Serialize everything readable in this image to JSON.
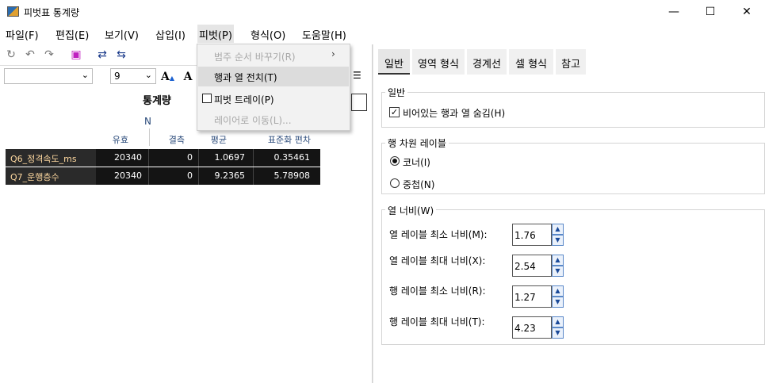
{
  "window": {
    "title": "피벗표 통계량",
    "minimize": "—",
    "maximize": "☐",
    "close": "✕"
  },
  "menubar": [
    {
      "label": "파일(F)"
    },
    {
      "label": "편집(E)"
    },
    {
      "label": "보기(V)"
    },
    {
      "label": "삽입(I)"
    },
    {
      "label": "피벗(P)"
    },
    {
      "label": "형식(O)"
    },
    {
      "label": "도움말(H)"
    }
  ],
  "toolbar": {
    "font_size": "9",
    "font_name": ""
  },
  "pivot_menu": {
    "items": [
      {
        "label": "범주 순서 바꾸기(R)",
        "submenu_arrow": "›",
        "enabled": false
      },
      {
        "label": "행과 열 전치(T)",
        "enabled": true,
        "highlighted": true
      },
      {
        "label": "피벗 트레이(P)",
        "enabled": true,
        "checked": false
      },
      {
        "label": "레이어로 이동(L)...",
        "enabled": false
      }
    ]
  },
  "table": {
    "title": "통계량",
    "n_header": "N",
    "columns": [
      "유효",
      "결측",
      "평균",
      "표준화 편차"
    ],
    "rows": [
      {
        "label": "Q6_정격속도_ms",
        "values": [
          "20340",
          "0",
          "1.0697",
          "0.35461"
        ]
      },
      {
        "label": "Q7_운행층수",
        "values": [
          "20340",
          "0",
          "9.2365",
          "5.78908"
        ]
      }
    ]
  },
  "tabs": [
    {
      "label": "일반",
      "active": true
    },
    {
      "label": "영역 형식",
      "active": false
    },
    {
      "label": "경계선",
      "active": false
    },
    {
      "label": "셀 형식",
      "active": false
    },
    {
      "label": "참고",
      "active": false
    }
  ],
  "general": {
    "group_label": "일반",
    "hide_empty_label": "비어있는 행과 열 숨김(H)",
    "hide_empty_checked": true
  },
  "row_dim": {
    "group_label": "행 차원 레이블",
    "corner_label": "코너(I)",
    "nested_label": "중첩(N)",
    "selected": "corner"
  },
  "col_width": {
    "group_label": "열 너비(W)",
    "fields": [
      {
        "label": "열 레이블 최소 너비(M):",
        "value": "1.76"
      },
      {
        "label": "열 레이블 최대 너비(X):",
        "value": "2.54"
      },
      {
        "label": "행 레이블 최소 너비(R):",
        "value": "1.27"
      },
      {
        "label": "행 레이블 최대 너비(T):",
        "value": "4.23"
      }
    ]
  }
}
